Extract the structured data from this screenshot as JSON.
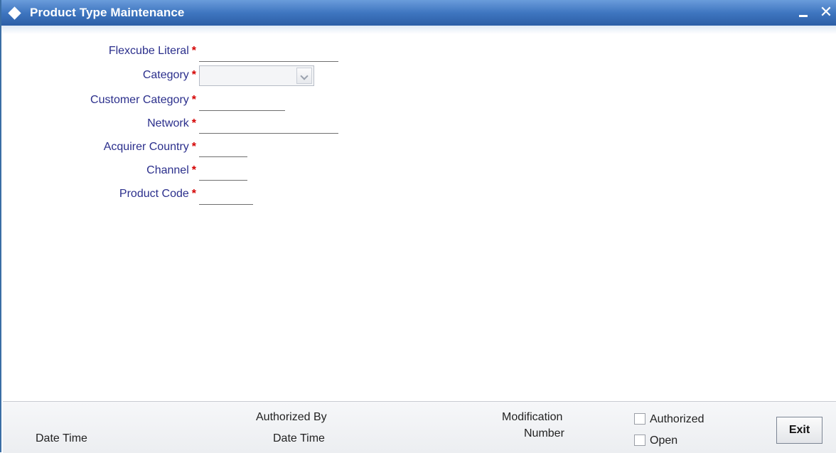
{
  "window": {
    "title": "Product Type Maintenance",
    "minimize_glyph": "_",
    "close_glyph": "✕"
  },
  "form": {
    "flexcube_literal": {
      "label": "Flexcube Literal",
      "required": "*",
      "value": ""
    },
    "category": {
      "label": "Category",
      "required": "*",
      "value": ""
    },
    "customer_category": {
      "label": "Customer Category",
      "required": "*",
      "value": ""
    },
    "network": {
      "label": "Network",
      "required": "*",
      "value": ""
    },
    "acquirer_country": {
      "label": "Acquirer Country",
      "required": "*",
      "value": ""
    },
    "channel": {
      "label": "Channel",
      "required": "*",
      "value": ""
    },
    "product_code": {
      "label": "Product Code",
      "required": "*",
      "value": ""
    }
  },
  "footer": {
    "date_time": "Date Time",
    "authorized_by": "Authorized By",
    "authorized_date_time": "Date Time",
    "modification": "Modification",
    "number": "Number",
    "authorized_label": "Authorized",
    "open_label": "Open",
    "exit_label": "Exit"
  },
  "colors": {
    "title_bar": "#3f76c0",
    "label_text": "#2b2f8c",
    "required_mark": "#d40000"
  },
  "icons": {
    "title": "diamond-icon",
    "minimize": "minimize-icon",
    "close": "close-icon",
    "dropdown": "chevron-down-icon"
  }
}
